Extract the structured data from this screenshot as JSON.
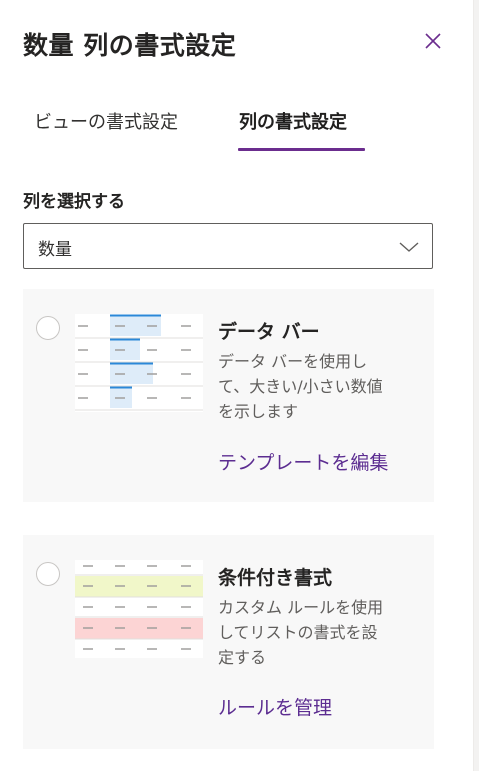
{
  "panel": {
    "title": "数量 列の書式設定",
    "close_icon": "close-icon"
  },
  "tabs": [
    {
      "label": "ビューの書式設定",
      "active": false
    },
    {
      "label": "列の書式設定",
      "active": true
    }
  ],
  "column_select": {
    "label": "列を選択する",
    "value": "数量",
    "icon": "chevron-down-icon"
  },
  "options": [
    {
      "title": "データ バー",
      "description_lines": [
        "データ バーを使用し",
        "て、大きい/小さい数値",
        "を示します"
      ],
      "link": "テンプレートを編集",
      "selected": false
    },
    {
      "title": "条件付き書式",
      "description_lines": [
        "カスタム ルールを使用",
        "してリストの書式を設",
        "定する"
      ],
      "link": "ルールを管理",
      "selected": false
    }
  ],
  "colors": {
    "accent": "#6b2d8e",
    "link": "#5c2d91",
    "bar_fill": "#deecf9",
    "bar_line": "#2b88d8",
    "row_highlight_green": "#f1f7c9",
    "row_highlight_red": "#fcd4d4"
  }
}
